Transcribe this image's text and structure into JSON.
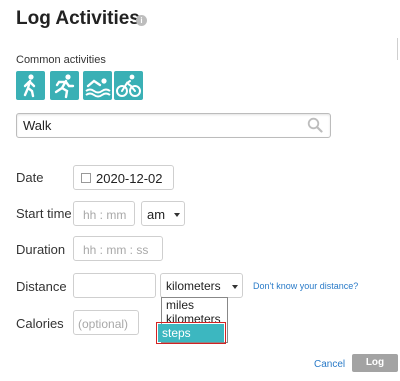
{
  "header": {
    "title": "Log Activities",
    "info_icon": "info-icon"
  },
  "activities": {
    "label": "Common activities",
    "buttons": [
      {
        "name": "walk",
        "icon": "walking-icon"
      },
      {
        "name": "run",
        "icon": "running-icon"
      },
      {
        "name": "swim",
        "icon": "swimming-icon"
      },
      {
        "name": "bike",
        "icon": "cycling-icon"
      }
    ],
    "accent_color": "#3ab0b5"
  },
  "search": {
    "value": "Walk",
    "icon": "search-icon"
  },
  "form": {
    "date_label": "Date",
    "date_value": "2020-12-02",
    "start_time_label": "Start time",
    "start_time_placeholder": "hh : mm",
    "ampm_value": "am",
    "duration_label": "Duration",
    "duration_placeholder": "hh : mm : ss",
    "distance_label": "Distance",
    "distance_unit": "kilometers",
    "distance_help_link": "Don't know your distance?",
    "calories_label": "Calories",
    "calories_placeholder": "(optional)"
  },
  "unit_dropdown": {
    "options": [
      "miles",
      "kilometers",
      "steps"
    ],
    "highlighted": "steps",
    "highlight_color": "#3cb7c0",
    "outline_color": "#d22222"
  },
  "footer": {
    "cancel_label": "Cancel",
    "log_label": "Log"
  }
}
